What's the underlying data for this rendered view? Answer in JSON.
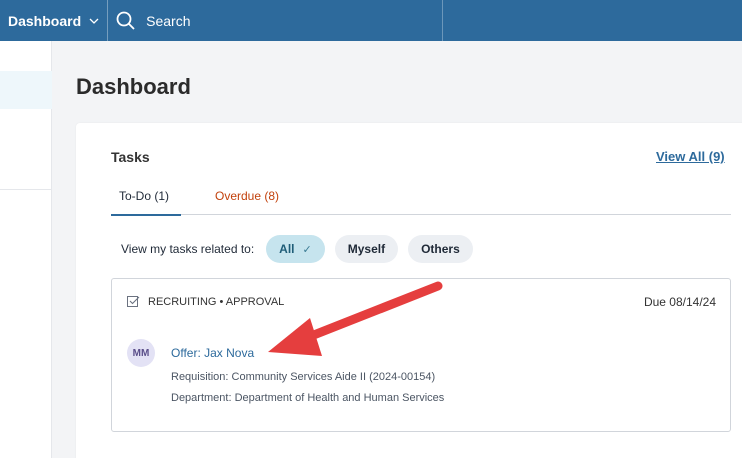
{
  "topbar": {
    "menu_label": "Dashboard",
    "search_label": "Search"
  },
  "page": {
    "title": "Dashboard"
  },
  "tasks_card": {
    "title": "Tasks",
    "view_all": "View All (9)",
    "tabs": [
      {
        "label": "To-Do (1)"
      },
      {
        "label": "Overdue (8)"
      }
    ],
    "filter_label": "View my tasks related to:",
    "filters": [
      {
        "label": "All",
        "selected": true
      },
      {
        "label": "Myself"
      },
      {
        "label": "Others"
      }
    ],
    "task": {
      "category": "RECRUITING • APPROVAL",
      "due": "Due 08/14/24",
      "avatar_initials": "MM",
      "title": "Offer: Jax Nova",
      "requisition": "Requisition: Community Services Aide II (2024-00154)",
      "department": "Department: Department of Health and Human Services"
    }
  },
  "colors": {
    "brand": "#2d6a9c",
    "overdue": "#c2410c",
    "annotation_arrow": "#e53e3e"
  }
}
